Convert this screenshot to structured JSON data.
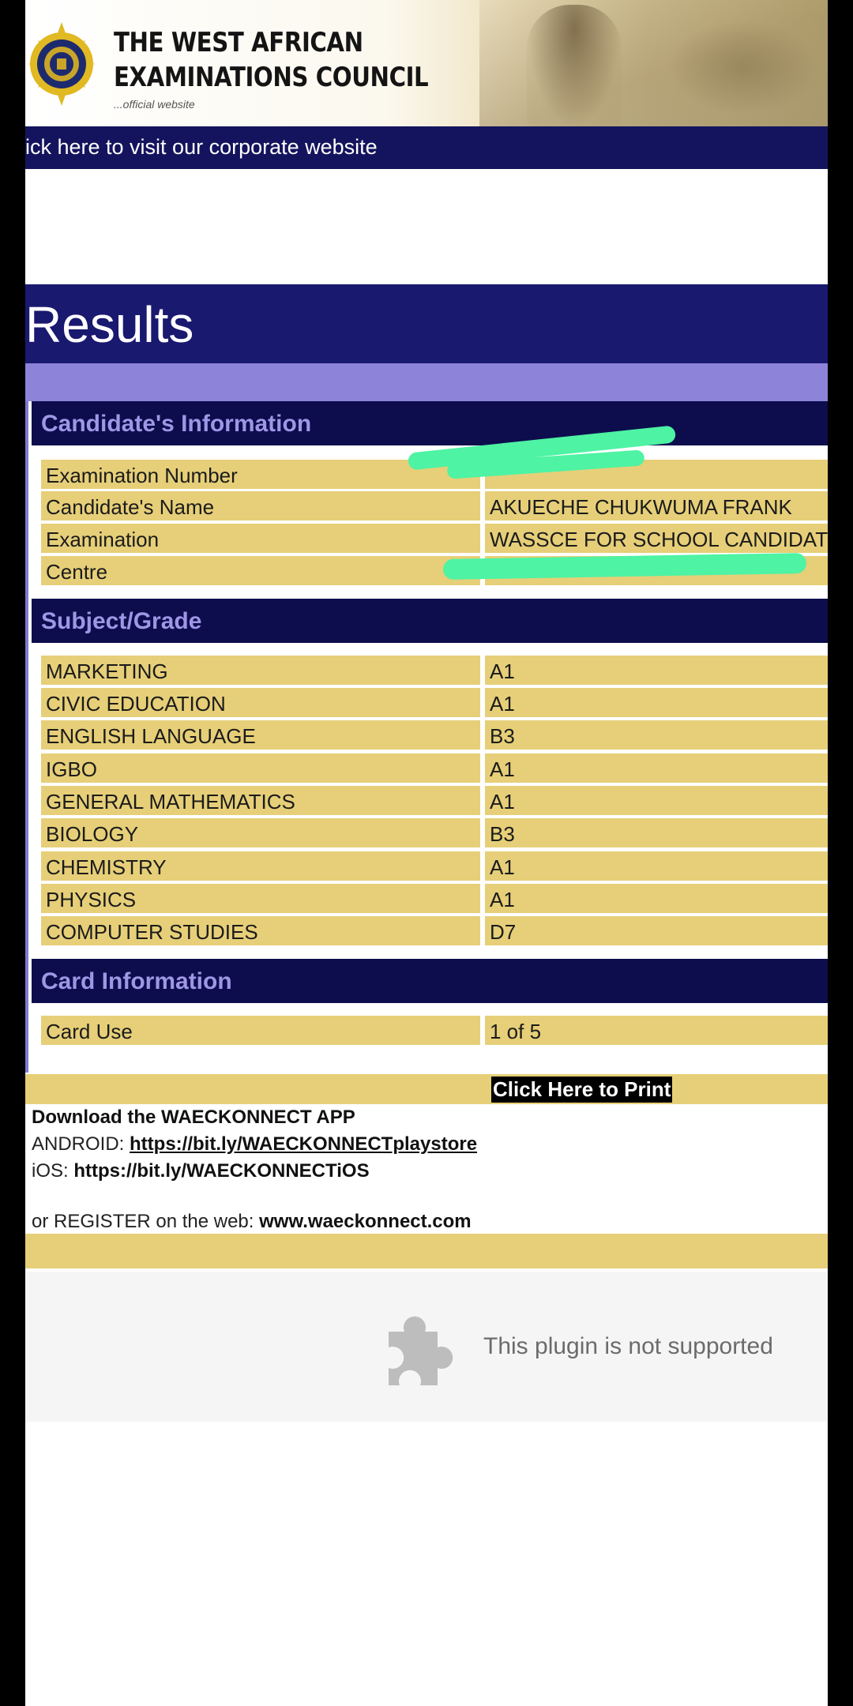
{
  "header": {
    "org_line1": "THE WEST AFRICAN",
    "org_line2": "EXAMINATIONS COUNCIL",
    "tagline": "...official website",
    "logo_icon": "waec-crest-icon"
  },
  "corporate_bar": {
    "text": "ick here to visit our corporate website"
  },
  "results": {
    "title": "Results"
  },
  "candidate_info": {
    "heading": "Candidate's Information",
    "rows": [
      {
        "label": "Examination Number",
        "value": ""
      },
      {
        "label": "Candidate's Name",
        "value": "AKUECHE CHUKWUMA FRANK"
      },
      {
        "label": "Examination",
        "value": "WASSCE FOR SCHOOL CANDIDAT"
      },
      {
        "label": "Centre",
        "value": ""
      }
    ]
  },
  "subject_grade": {
    "heading": "Subject/Grade",
    "rows": [
      {
        "subject": "MARKETING",
        "grade": "A1"
      },
      {
        "subject": "CIVIC EDUCATION",
        "grade": "A1"
      },
      {
        "subject": "ENGLISH LANGUAGE",
        "grade": "B3"
      },
      {
        "subject": "IGBO",
        "grade": "A1"
      },
      {
        "subject": "GENERAL MATHEMATICS",
        "grade": "A1"
      },
      {
        "subject": "BIOLOGY",
        "grade": "B3"
      },
      {
        "subject": "CHEMISTRY",
        "grade": "A1"
      },
      {
        "subject": "PHYSICS",
        "grade": "A1"
      },
      {
        "subject": "COMPUTER STUDIES",
        "grade": "D7"
      }
    ]
  },
  "card_info": {
    "heading": "Card Information",
    "rows": [
      {
        "label": "Card Use",
        "value": "1 of 5"
      }
    ]
  },
  "print": {
    "label": "Click Here to Print"
  },
  "app_promo": {
    "title": "Download the WAECKONNECT APP",
    "android_label": "ANDROID: ",
    "android_link": "https://bit.ly/WAECKONNECTplaystore",
    "ios_label": "iOS: ",
    "ios_link": "https://bit.ly/WAECKONNECTiOS",
    "register_label": "or REGISTER on the web: ",
    "register_link": "www.waeckonnect.com"
  },
  "plugin": {
    "message": "This plugin is not supported",
    "icon": "puzzle-piece-icon"
  },
  "colors": {
    "navy": "#0d0d4d",
    "title_band": "#191970",
    "lavender": "#8d83d8",
    "cell_yellow": "#e6cf78",
    "redaction_green": "#4ef3a3"
  }
}
